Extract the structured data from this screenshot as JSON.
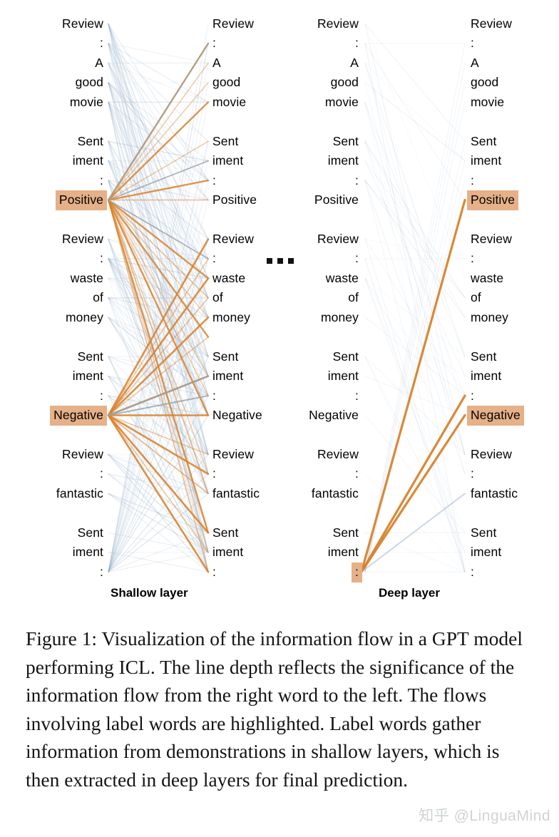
{
  "figure": {
    "tokens": [
      "Review",
      ":",
      "A",
      "good",
      "movie",
      "",
      "Sent",
      "iment",
      ":",
      "Positive",
      "",
      "Review",
      ":",
      "waste",
      "of",
      "money",
      "",
      "Sent",
      "iment",
      ":",
      "Negative",
      "",
      "Review",
      ":",
      "fantastic",
      "",
      "Sent",
      "iment",
      ":"
    ],
    "highlighted_rows_shallow": [
      9,
      20
    ],
    "highlighted_rows_deep": [
      9,
      20,
      28
    ],
    "ellipsis": "...",
    "labels": {
      "shallow": "Shallow layer",
      "deep": "Deep layer"
    },
    "colors": {
      "highlight": "#e6b088",
      "flow_orange": "#d9822b",
      "flow_blue": "#8ba8c4",
      "text": "#000000",
      "background": "#ffffff"
    }
  },
  "caption": {
    "text": "Figure 1: Visualization of the information flow in a GPT model performing ICL. The line depth reflects the significance of the information flow from the right word to the left. The flows involving label words are highlighted. Label words gather information from demonstrations in shallow layers, which is then extracted in deep layers for final prediction."
  },
  "watermark": {
    "text": "知乎 @LinguaMind"
  },
  "chart_data": {
    "type": "diagram",
    "title": "Information flow in a GPT model performing ICL",
    "panels": [
      {
        "name": "Shallow layer",
        "left_column_align": "right",
        "right_column_align": "left",
        "description": "Dense web of many faint blue and orange flow lines converging into the two highlighted label words 'Positive' and 'Negative' on the left column, indicating label words gathering information from demonstration words.",
        "dominant_color": "#8ba8c4",
        "emphasis_color": "#d9822b",
        "line_count_estimate": 220,
        "highlighted_targets": [
          "Positive",
          "Negative"
        ]
      },
      {
        "name": "Deep layer",
        "left_column_align": "right",
        "right_column_align": "left",
        "description": "Sparse, mostly faint lines with three strong orange flows originating from the final highlighted ':' token at the bottom and reaching up to the highlighted 'Positive' and 'Negative' label words, indicating extraction of label information for final prediction.",
        "dominant_color": "#e8edf2",
        "emphasis_color": "#d9822b",
        "line_count_estimate": 30,
        "highlighted_targets": [
          "Positive",
          "Negative",
          ":"
        ]
      }
    ]
  }
}
